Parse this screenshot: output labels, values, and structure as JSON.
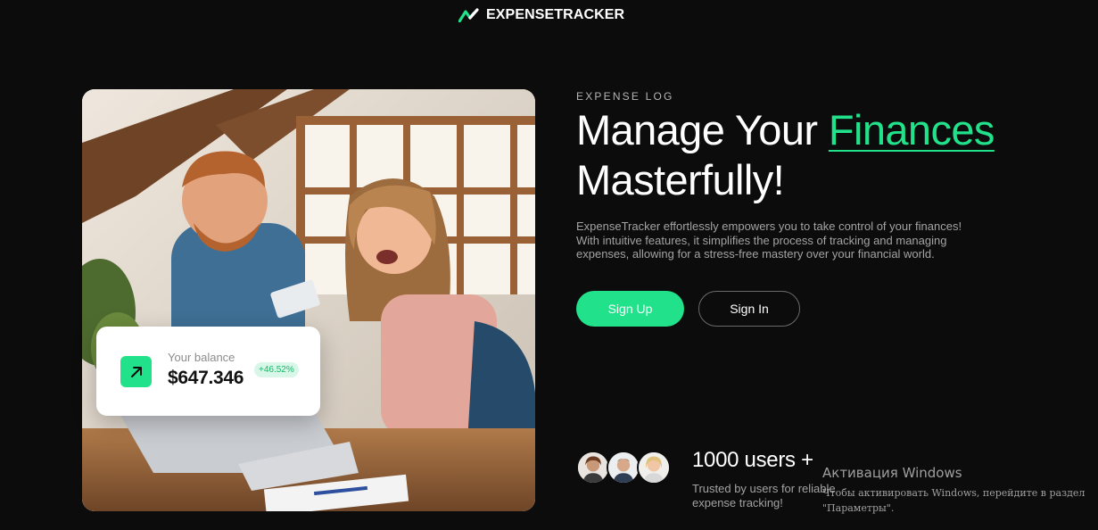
{
  "brand": {
    "name": "EXPENSETRACKER",
    "accent_color": "#21e28a"
  },
  "hero": {
    "eyebrow": "EXPENSE LOG",
    "headline_part1": "Manage Your ",
    "headline_accent": "Finances",
    "headline_part2": "Masterfully!",
    "description": "ExpenseTracker effortlessly empowers you to take control of your finances! With intuitive features, it simplifies the process of tracking and managing expenses, allowing for a stress-free mastery over your financial world."
  },
  "buttons": {
    "signup_label": "Sign Up",
    "signin_label": "Sign In"
  },
  "balance_card": {
    "label": "Your balance",
    "value": "$647.346",
    "change": "+46.52%",
    "icon": "arrow-up-right-icon"
  },
  "users": {
    "count": "1000 users +",
    "description": "Trusted by users for reliable expense tracking!"
  },
  "windows_watermark": {
    "title": "Активация Windows",
    "text": "Чтобы активировать Windows, перейдите в раздел \"Параметры\"."
  }
}
